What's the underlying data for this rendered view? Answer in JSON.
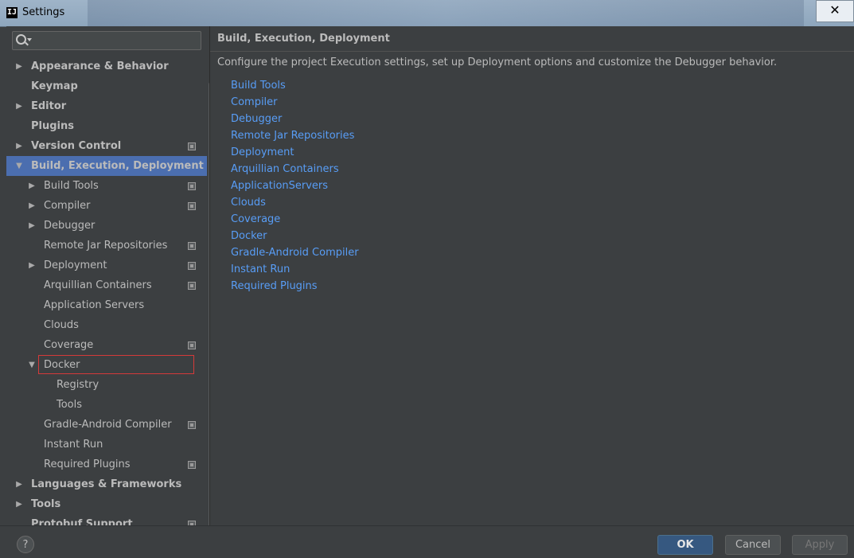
{
  "window": {
    "title": "Settings",
    "app_icon": "IJ",
    "close_glyph": "✕"
  },
  "search": {
    "placeholder": ""
  },
  "tree": [
    {
      "label": "Appearance & Behavior",
      "level": 0,
      "arrow": "right",
      "project": false
    },
    {
      "label": "Keymap",
      "level": 0,
      "arrow": "none",
      "project": false
    },
    {
      "label": "Editor",
      "level": 0,
      "arrow": "right",
      "project": false
    },
    {
      "label": "Plugins",
      "level": 0,
      "arrow": "none",
      "project": false
    },
    {
      "label": "Version Control",
      "level": 0,
      "arrow": "right",
      "project": true
    },
    {
      "label": "Build, Execution, Deployment",
      "level": 0,
      "arrow": "down",
      "project": false,
      "selected": true
    },
    {
      "label": "Build Tools",
      "level": 1,
      "arrow": "right",
      "project": true
    },
    {
      "label": "Compiler",
      "level": 1,
      "arrow": "right",
      "project": true
    },
    {
      "label": "Debugger",
      "level": 1,
      "arrow": "right",
      "project": false
    },
    {
      "label": "Remote Jar Repositories",
      "level": 1,
      "arrow": "none",
      "project": true
    },
    {
      "label": "Deployment",
      "level": 1,
      "arrow": "right",
      "project": true
    },
    {
      "label": "Arquillian Containers",
      "level": 1,
      "arrow": "none",
      "project": true
    },
    {
      "label": "Application Servers",
      "level": 1,
      "arrow": "none",
      "project": false
    },
    {
      "label": "Clouds",
      "level": 1,
      "arrow": "none",
      "project": false
    },
    {
      "label": "Coverage",
      "level": 1,
      "arrow": "none",
      "project": true
    },
    {
      "label": "Docker",
      "level": 1,
      "arrow": "down",
      "project": false,
      "highlighted": true
    },
    {
      "label": "Registry",
      "level": 2,
      "arrow": "none",
      "project": false
    },
    {
      "label": "Tools",
      "level": 2,
      "arrow": "none",
      "project": false
    },
    {
      "label": "Gradle-Android Compiler",
      "level": 1,
      "arrow": "none",
      "project": true
    },
    {
      "label": "Instant Run",
      "level": 1,
      "arrow": "none",
      "project": false
    },
    {
      "label": "Required Plugins",
      "level": 1,
      "arrow": "none",
      "project": true
    },
    {
      "label": "Languages & Frameworks",
      "level": 0,
      "arrow": "right",
      "project": false
    },
    {
      "label": "Tools",
      "level": 0,
      "arrow": "right",
      "project": false
    },
    {
      "label": "Protobuf Support",
      "level": 0,
      "arrow": "none",
      "project": true
    }
  ],
  "content": {
    "heading": "Build, Execution, Deployment",
    "description": "Configure the project Execution settings, set up Deployment options and customize the Debugger behavior.",
    "links": [
      "Build Tools",
      "Compiler",
      "Debugger",
      "Remote Jar Repositories",
      "Deployment",
      "Arquillian Containers",
      "ApplicationServers",
      "Clouds",
      "Coverage",
      "Docker",
      "Gradle-Android Compiler",
      "Instant Run",
      "Required Plugins"
    ]
  },
  "footer": {
    "help": "?",
    "ok": "OK",
    "cancel": "Cancel",
    "apply": "Apply"
  },
  "colors": {
    "selection": "#4b6eaf",
    "link": "#589df6",
    "highlight_border": "#d43a3a",
    "ok_button": "#365880"
  }
}
